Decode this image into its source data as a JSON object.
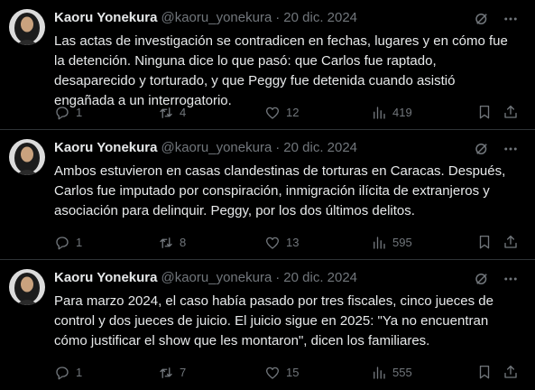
{
  "tweets": [
    {
      "author_name": "Kaoru Yonekura",
      "author_handle": "@kaoru_yonekura",
      "separator": "·",
      "date": "20 dic. 2024",
      "text": "Las actas de investigación se contradicen en fechas, lugares y en cómo fue\nla detención. Ninguna dice lo que pasó: que Carlos fue raptado,\ndesaparecido y torturado, y que Peggy fue detenida cuando asistió\nengañada a un interrogatorio.",
      "replies": "1",
      "reposts": "4",
      "likes": "12",
      "views": "419"
    },
    {
      "author_name": "Kaoru Yonekura",
      "author_handle": "@kaoru_yonekura",
      "separator": "·",
      "date": "20 dic. 2024",
      "text": "Ambos estuvieron en casas clandestinas de torturas en Caracas. Después,\nCarlos fue imputado por conspiración, inmigración ilícita de extranjeros y\nasociación para delinquir. Peggy, por los dos últimos delitos.",
      "replies": "1",
      "reposts": "8",
      "likes": "13",
      "views": "595"
    },
    {
      "author_name": "Kaoru Yonekura",
      "author_handle": "@kaoru_yonekura",
      "separator": "·",
      "date": "20 dic. 2024",
      "text": "Para marzo 2024, el caso había pasado por tres fiscales, cinco jueces de\ncontrol y dos jueces de juicio. El juicio sigue en 2025: \"Ya no encuentran\ncómo justificar el show que les montaron\", dicen los familiares.",
      "replies": "1",
      "reposts": "7",
      "likes": "15",
      "views": "555"
    }
  ],
  "icons": [
    "grok-icon",
    "more-icon",
    "reply-icon",
    "repost-icon",
    "like-icon",
    "views-icon",
    "bookmark-icon",
    "share-icon"
  ],
  "colors": {
    "background": "#000000",
    "text": "#e7e9ea",
    "secondary": "#71767b",
    "divider": "#2f3336"
  }
}
